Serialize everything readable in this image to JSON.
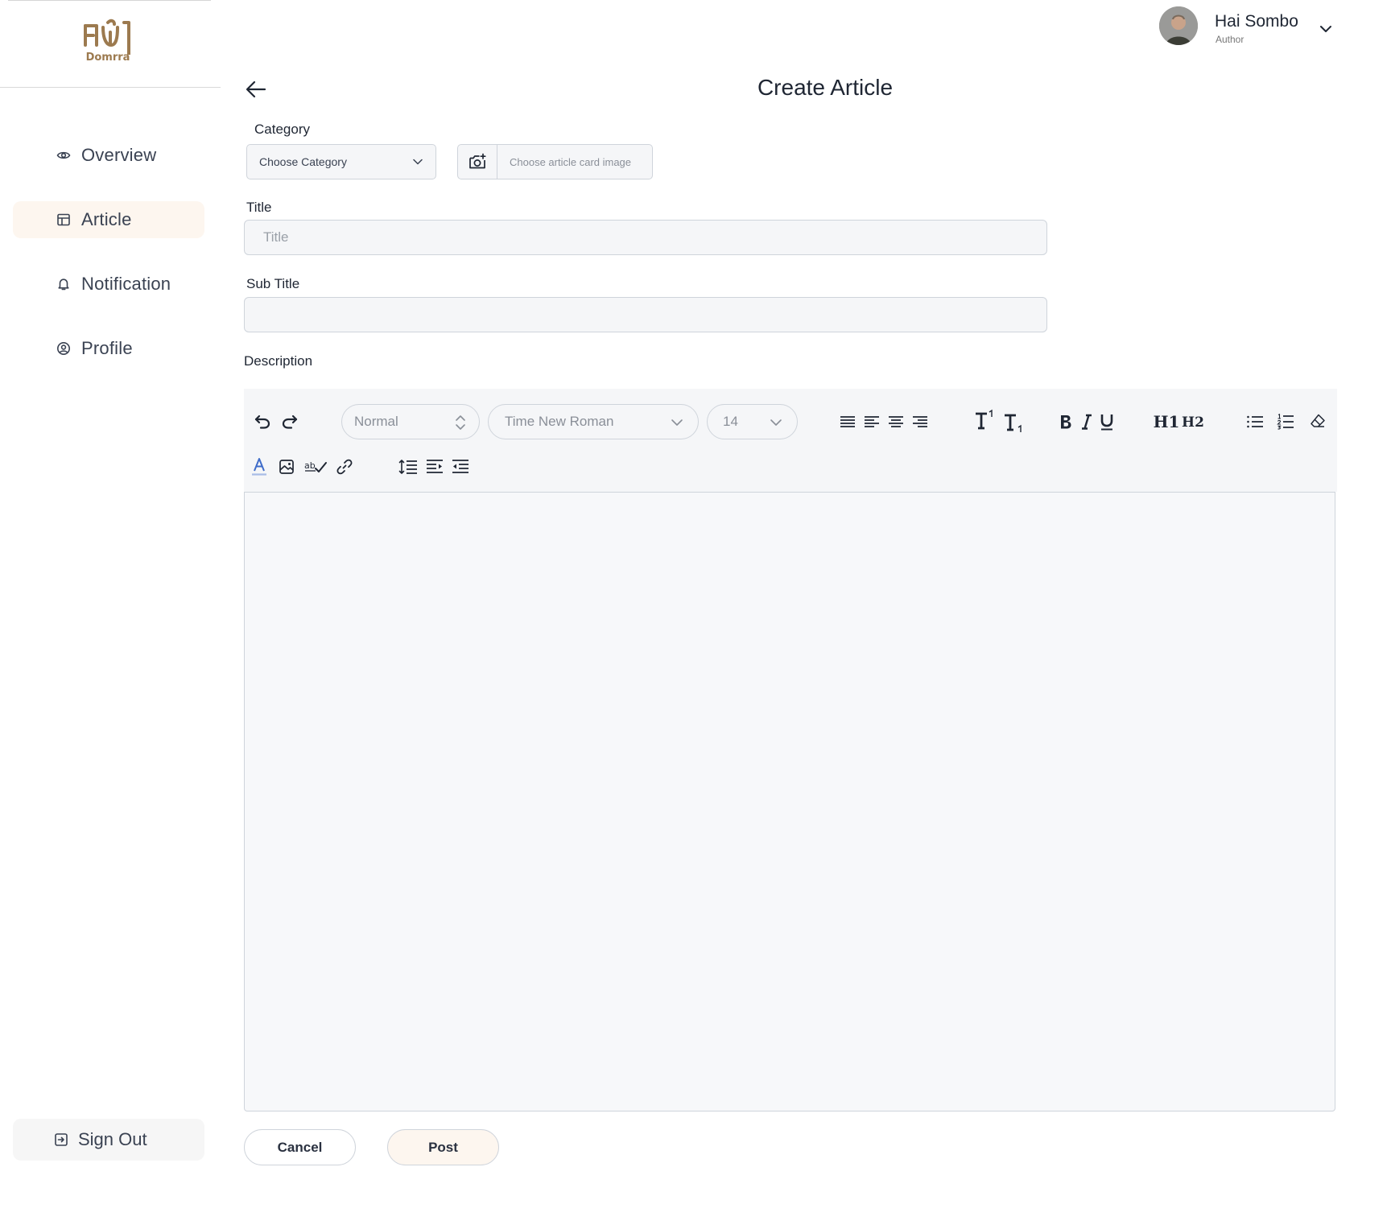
{
  "brand": {
    "name": "Domrra",
    "accent": "#9c7a4f"
  },
  "sidebar": {
    "items": [
      {
        "label": "Overview",
        "icon": "eye-icon",
        "active": false
      },
      {
        "label": "Article",
        "icon": "layout-icon",
        "active": true
      },
      {
        "label": "Notification",
        "icon": "bell-icon",
        "active": false
      },
      {
        "label": "Profile",
        "icon": "user-circle-icon",
        "active": false
      }
    ],
    "sign_out": "Sign Out"
  },
  "user": {
    "name": "Hai Sombo",
    "role": "Author"
  },
  "page": {
    "title": "Create Article"
  },
  "form": {
    "category_label": "Category",
    "category_placeholder": "Choose Category",
    "image_placeholder": "Choose article card image",
    "title_label": "Title",
    "title_placeholder": "Title",
    "subtitle_label": "Sub Title",
    "subtitle_value": "",
    "description_label": "Description"
  },
  "editor": {
    "style_value": "Normal",
    "font_value": "Time New Roman",
    "size_value": "14",
    "h1": "H1",
    "h2": "H2"
  },
  "actions": {
    "cancel": "Cancel",
    "post": "Post"
  }
}
